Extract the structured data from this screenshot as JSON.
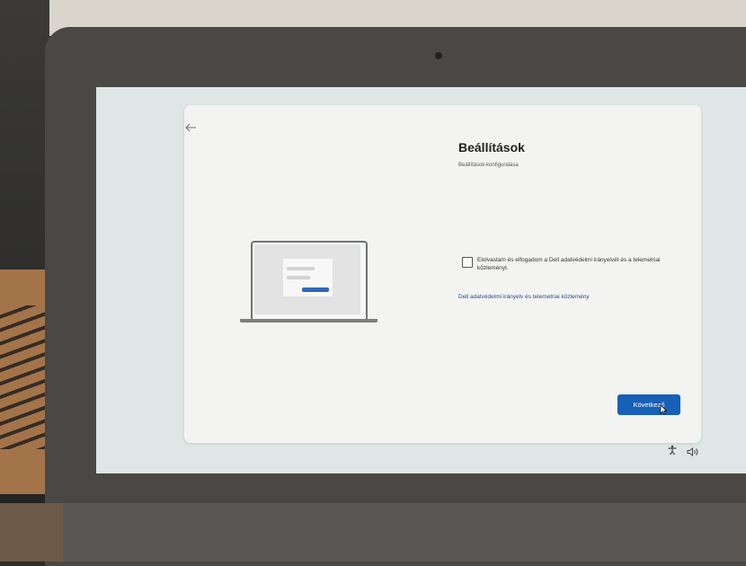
{
  "dialog": {
    "back_icon": "arrow-left-icon",
    "title": "Beállítások",
    "subtitle": "Beállítások konfigurálása",
    "checkbox_label": "Elolvastam és elfogadom a Dell adatvédelmi irányelvét és a telemetriai közleményt.",
    "checkbox_checked": false,
    "privacy_link": "Dell adatvédelmi irányelv és telemetriai közlemény",
    "next_button": "Következő",
    "accent_color": "#1660b8"
  },
  "tray": {
    "icons": [
      "accessibility-icon",
      "volume-icon"
    ]
  }
}
